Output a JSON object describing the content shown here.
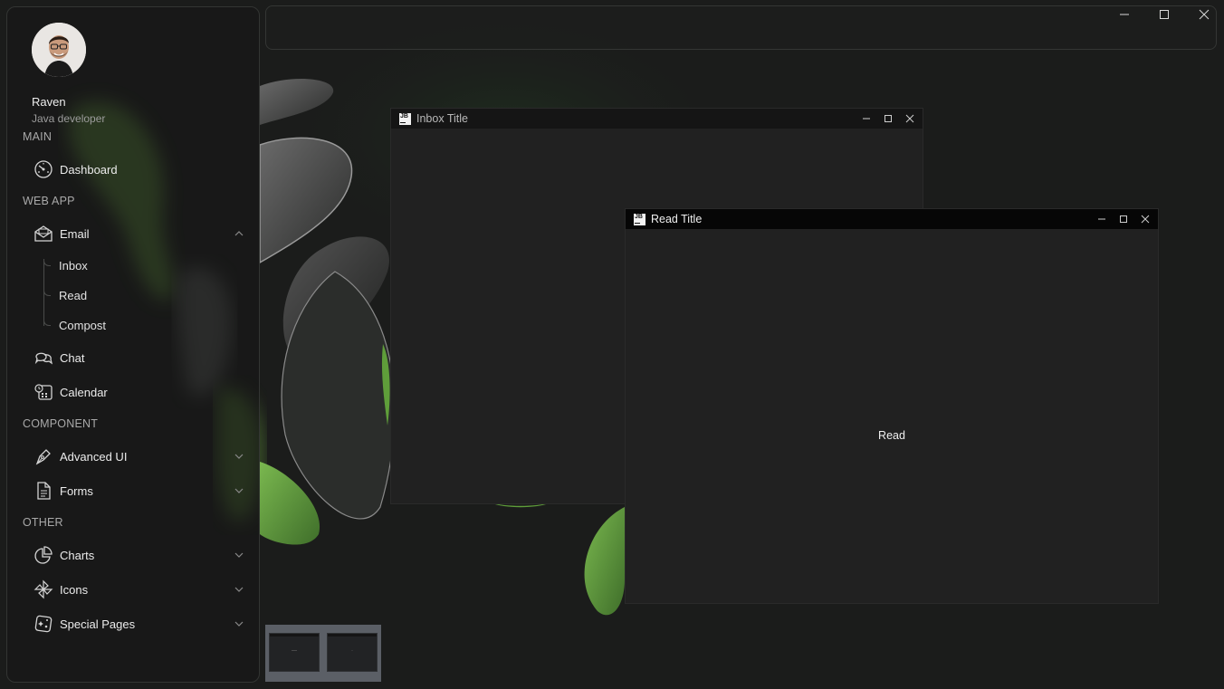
{
  "window_controls": {
    "minimize": "minimize",
    "maximize": "maximize",
    "close": "close"
  },
  "profile": {
    "name": "Raven",
    "role": "Java developer"
  },
  "sidebar": {
    "sections": {
      "main": "MAIN",
      "web_app": "WEB APP",
      "component": "COMPONENT",
      "other": "OTHER"
    },
    "items": {
      "dashboard": {
        "label": "Dashboard",
        "icon": "gauge-icon"
      },
      "email": {
        "label": "Email",
        "icon": "envelope-icon",
        "expanded": true
      },
      "chat": {
        "label": "Chat",
        "icon": "chat-bubbles-icon"
      },
      "calendar": {
        "label": "Calendar",
        "icon": "calendar-icon"
      },
      "advanced_ui": {
        "label": "Advanced UI",
        "icon": "pen-nib-icon"
      },
      "forms": {
        "label": "Forms",
        "icon": "document-icon"
      },
      "charts": {
        "label": "Charts",
        "icon": "pie-chart-icon"
      },
      "icons": {
        "label": "Icons",
        "icon": "pinwheel-icon"
      },
      "special_pages": {
        "label": "Special Pages",
        "icon": "sparkle-square-icon"
      }
    },
    "email_sub": [
      "Inbox",
      "Read",
      "Compost"
    ]
  },
  "frames": {
    "inbox": {
      "title": "Inbox Title",
      "logo": "JB"
    },
    "read": {
      "title": "Read Title",
      "logo": "JB",
      "content": "Read"
    }
  },
  "colors": {
    "background": "#1b1c1b",
    "accent_green": "#5f9e3a",
    "sidebar_border": "#333533"
  }
}
